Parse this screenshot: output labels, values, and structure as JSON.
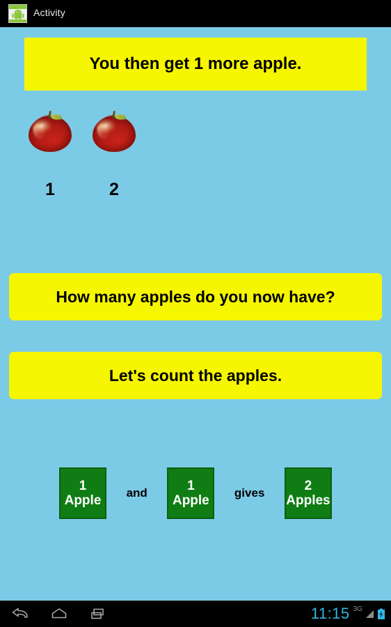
{
  "titlebar": {
    "icon": "android-app-icon",
    "title": "Activity"
  },
  "colors": {
    "background": "#7ccbe6",
    "banner": "#f6f600",
    "banner_text": "#000000",
    "box": "#0f7d14",
    "box_border": "#0a5f10",
    "box_text": "#ffffff",
    "titlebar": "#000000",
    "clock": "#33b5e5"
  },
  "banners": {
    "statement": "You then get 1 more apple.",
    "question": "How many apples do you now have?",
    "instruction": "Let's count the apples."
  },
  "apples": [
    {
      "label": "1"
    },
    {
      "label": "2"
    }
  ],
  "equation": {
    "boxes": [
      {
        "number": "1",
        "word": "Apple"
      },
      {
        "number": "1",
        "word": "Apple"
      },
      {
        "number": "2",
        "word": "Apples"
      }
    ],
    "operators": [
      "and",
      "gives"
    ]
  },
  "navbar": {
    "back": "back-icon",
    "home": "home-icon",
    "recents": "recents-icon",
    "clock": "11:15",
    "network": "3G",
    "signal": "signal-icon",
    "battery": "battery-charging-icon"
  }
}
